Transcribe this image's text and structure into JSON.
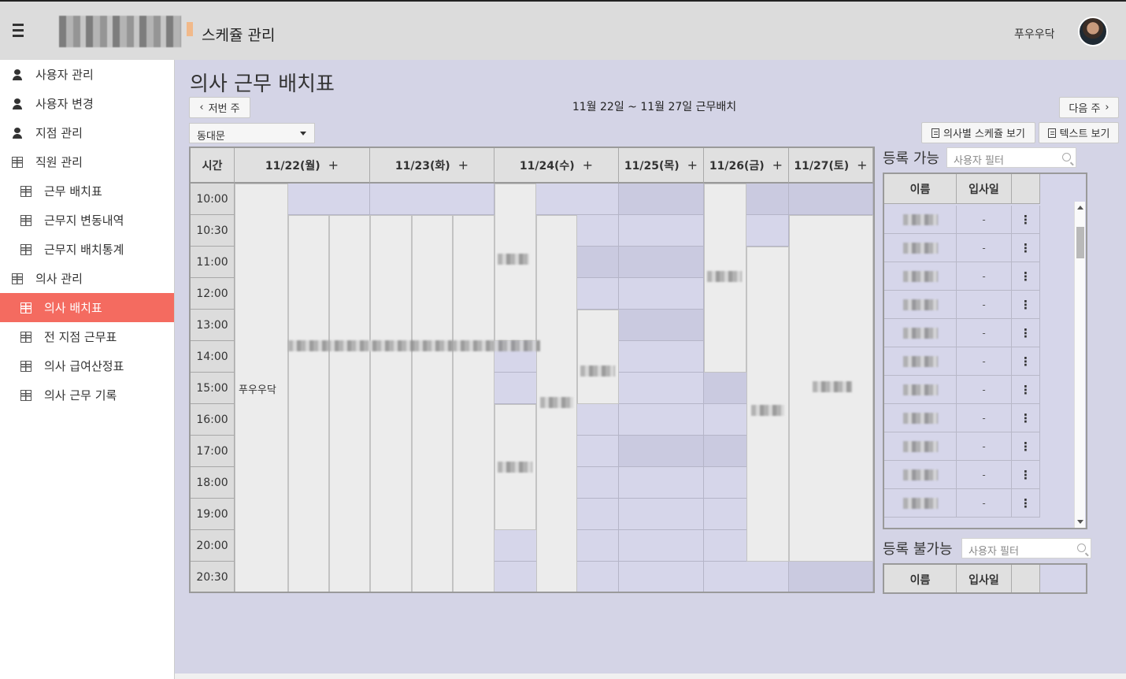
{
  "app": {
    "title": "스케쥴 관리",
    "user_name": "푸우우닥"
  },
  "sidebar": {
    "items": [
      {
        "label": "사용자 관리",
        "icon": "person-icon",
        "level": 0,
        "active": false
      },
      {
        "label": "사용자 변경",
        "icon": "person-icon",
        "level": 0,
        "active": false
      },
      {
        "label": "지점 관리",
        "icon": "person-icon",
        "level": 0,
        "active": false
      },
      {
        "label": "직원 관리",
        "icon": "grid-icon",
        "level": 0,
        "active": false
      },
      {
        "label": "근무 배치표",
        "icon": "grid-icon",
        "level": 1,
        "active": false
      },
      {
        "label": "근무지 변동내역",
        "icon": "grid-icon",
        "level": 1,
        "active": false
      },
      {
        "label": "근무지 배치통계",
        "icon": "grid-icon",
        "level": 1,
        "active": false
      },
      {
        "label": "의사 관리",
        "icon": "grid-icon",
        "level": 0,
        "active": false
      },
      {
        "label": "의사 배치표",
        "icon": "grid-icon",
        "level": 1,
        "active": true
      },
      {
        "label": "전 지점 근무표",
        "icon": "grid-icon",
        "level": 1,
        "active": false
      },
      {
        "label": "의사 급여산정표",
        "icon": "grid-icon",
        "level": 1,
        "active": false
      },
      {
        "label": "의사 근무 기록",
        "icon": "grid-icon",
        "level": 1,
        "active": false
      }
    ]
  },
  "main": {
    "title": "의사 근무 배치표",
    "prev_week": "저번 주",
    "next_week": "다음 주",
    "week_range": "11월 22일 ~ 11월 27일 근무배치",
    "branch_select": "동대문",
    "btn_schedule_by_doctor": "의사별 스케쥴 보기",
    "btn_text_view": "텍스트 보기",
    "grid": {
      "time_header": "시간",
      "days": [
        "11/22(월)",
        "11/23(화)",
        "11/24(수)",
        "11/25(목)",
        "11/26(금)",
        "11/27(토)"
      ],
      "add_symbol": "+",
      "times": [
        "10:00",
        "10:30",
        "11:00",
        "12:00",
        "13:00",
        "14:00",
        "15:00",
        "16:00",
        "17:00",
        "18:00",
        "19:00",
        "20:00",
        "20:30"
      ],
      "visible_shift_label": "푸우우닥"
    },
    "available": {
      "title": "등록 가능",
      "filter_placeholder": "사용자 필터",
      "col_name": "이름",
      "col_join": "입사일",
      "row_join_value": "-",
      "row_menu": "⋮",
      "row_count": 11
    },
    "unavailable": {
      "title": "등록 불가능",
      "filter_placeholder": "사용자 필터",
      "col_name": "이름",
      "col_join": "입사일"
    }
  },
  "colors": {
    "active_menu": "#f46b60",
    "grid_bg": "#d6d6ea",
    "grid_alt": "#cacae0",
    "shift_bar": "#ececec"
  }
}
